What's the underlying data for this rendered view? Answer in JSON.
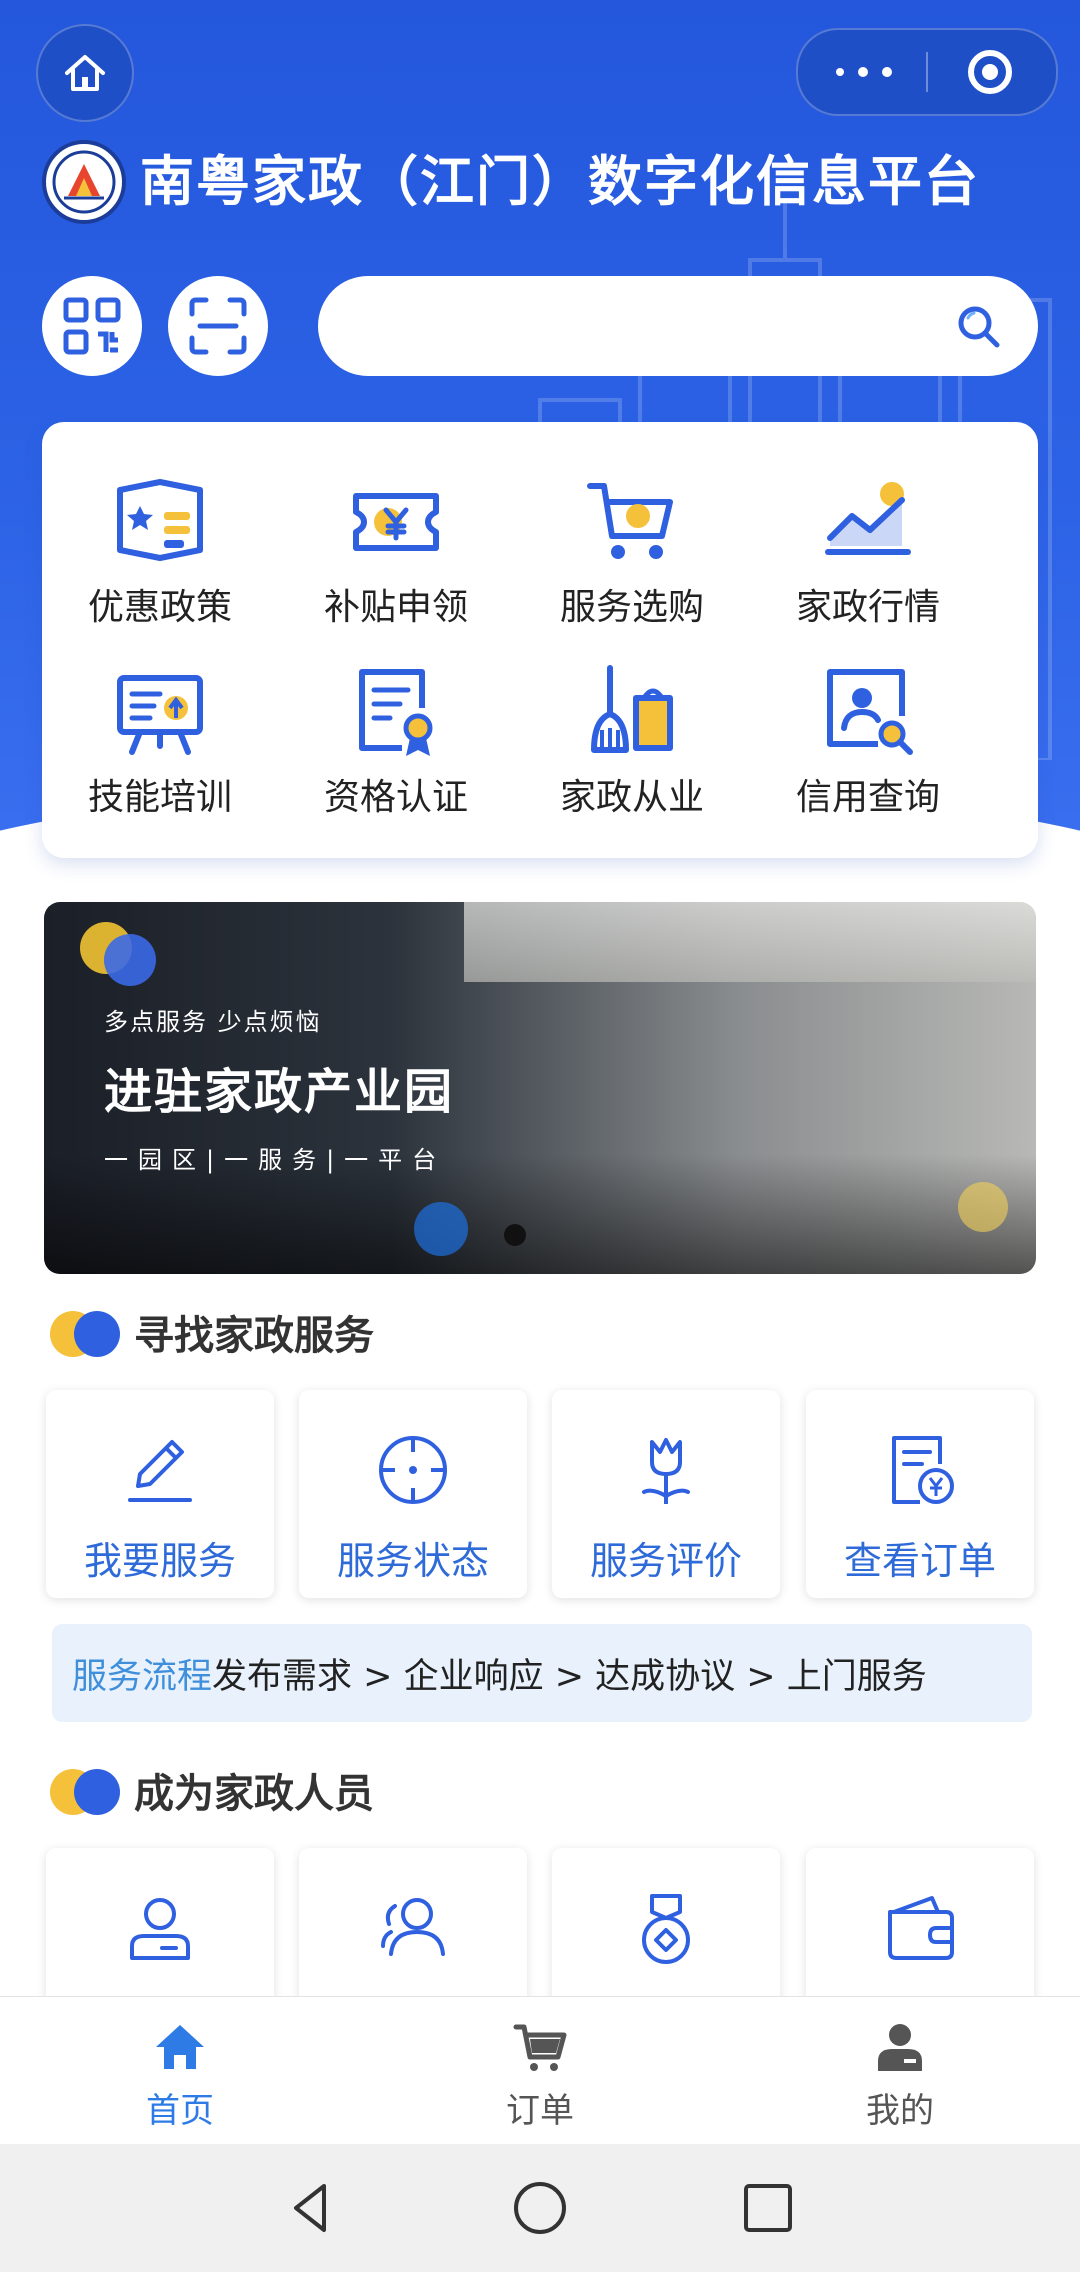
{
  "header": {
    "title": "南粤家政（江门）数字化信息平台",
    "home_icon": "home-icon",
    "search": {
      "placeholder": "",
      "value": ""
    }
  },
  "colors": {
    "primary": "#2d63e6",
    "accent_yellow": "#f5c13a",
    "link_blue": "#3f8fdb"
  },
  "grid": [
    {
      "label": "优惠政策",
      "icon": "policy-icon"
    },
    {
      "label": "补贴申领",
      "icon": "subsidy-icon"
    },
    {
      "label": "服务选购",
      "icon": "cart-icon"
    },
    {
      "label": "家政行情",
      "icon": "trend-icon"
    },
    {
      "label": "技能培训",
      "icon": "training-icon"
    },
    {
      "label": "资格认证",
      "icon": "certificate-icon"
    },
    {
      "label": "家政从业",
      "icon": "broom-icon"
    },
    {
      "label": "信用查询",
      "icon": "credit-search-icon"
    }
  ],
  "banner": {
    "subtitle": "多点服务 少点烦恼",
    "headline": "进驻家政产业园",
    "tagline": "一园区|一服务|一平台"
  },
  "section_find": {
    "title": "寻找家政服务",
    "tiles": [
      {
        "label": "我要服务",
        "icon": "pen-icon"
      },
      {
        "label": "服务状态",
        "icon": "crosshair-icon"
      },
      {
        "label": "服务评价",
        "icon": "flower-icon"
      },
      {
        "label": "查看订单",
        "icon": "order-yuan-icon"
      }
    ],
    "flow": {
      "label": "服务流程",
      "steps": "发布需求 > 企业响应 > 达成协议 > 上门服务"
    }
  },
  "section_become": {
    "title": "成为家政人员",
    "tiles": [
      {
        "icon": "person-card-icon"
      },
      {
        "icon": "group-icon"
      },
      {
        "icon": "medal-icon"
      },
      {
        "icon": "wallet-icon"
      }
    ]
  },
  "tabbar": [
    {
      "label": "首页",
      "icon": "home-icon",
      "active": true
    },
    {
      "label": "订单",
      "icon": "cart-icon",
      "active": false
    },
    {
      "label": "我的",
      "icon": "user-icon",
      "active": false
    }
  ]
}
